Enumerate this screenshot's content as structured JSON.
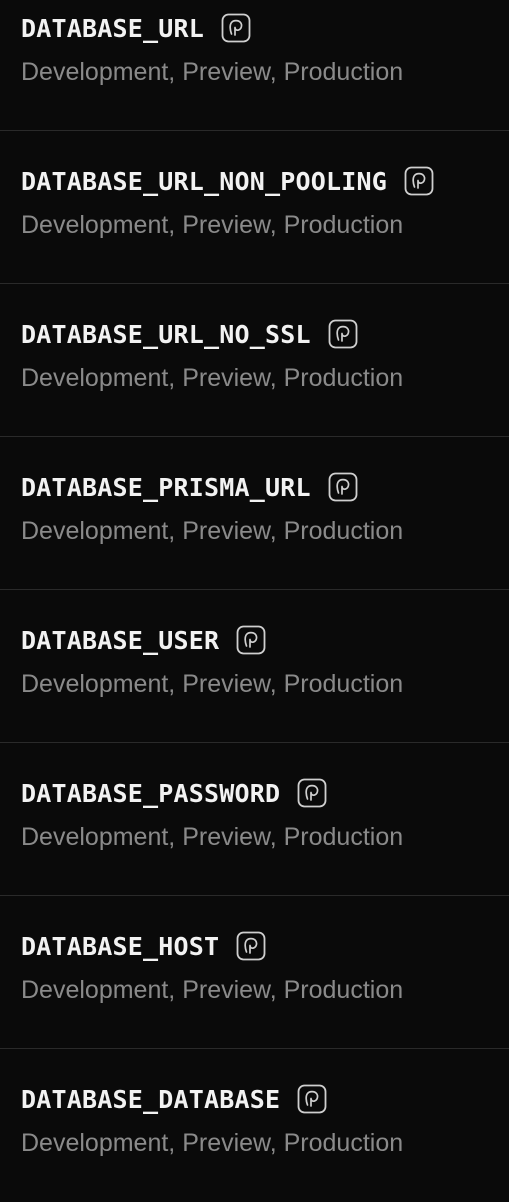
{
  "env_vars": [
    {
      "name": "DATABASE_URL",
      "targets": "Development, Preview, Production",
      "icon": "postgres-icon"
    },
    {
      "name": "DATABASE_URL_NON_POOLING",
      "targets": "Development, Preview, Production",
      "icon": "postgres-icon"
    },
    {
      "name": "DATABASE_URL_NO_SSL",
      "targets": "Development, Preview, Production",
      "icon": "postgres-icon"
    },
    {
      "name": "DATABASE_PRISMA_URL",
      "targets": "Development, Preview, Production",
      "icon": "postgres-icon"
    },
    {
      "name": "DATABASE_USER",
      "targets": "Development, Preview, Production",
      "icon": "postgres-icon"
    },
    {
      "name": "DATABASE_PASSWORD",
      "targets": "Development, Preview, Production",
      "icon": "postgres-icon"
    },
    {
      "name": "DATABASE_HOST",
      "targets": "Development, Preview, Production",
      "icon": "postgres-icon"
    },
    {
      "name": "DATABASE_DATABASE",
      "targets": "Development, Preview, Production",
      "icon": "postgres-icon"
    }
  ],
  "colors": {
    "background": "#0a0a0a",
    "name_text": "#f2f2f2",
    "target_text": "#8a8a8a",
    "divider": "#2a2a2a"
  }
}
